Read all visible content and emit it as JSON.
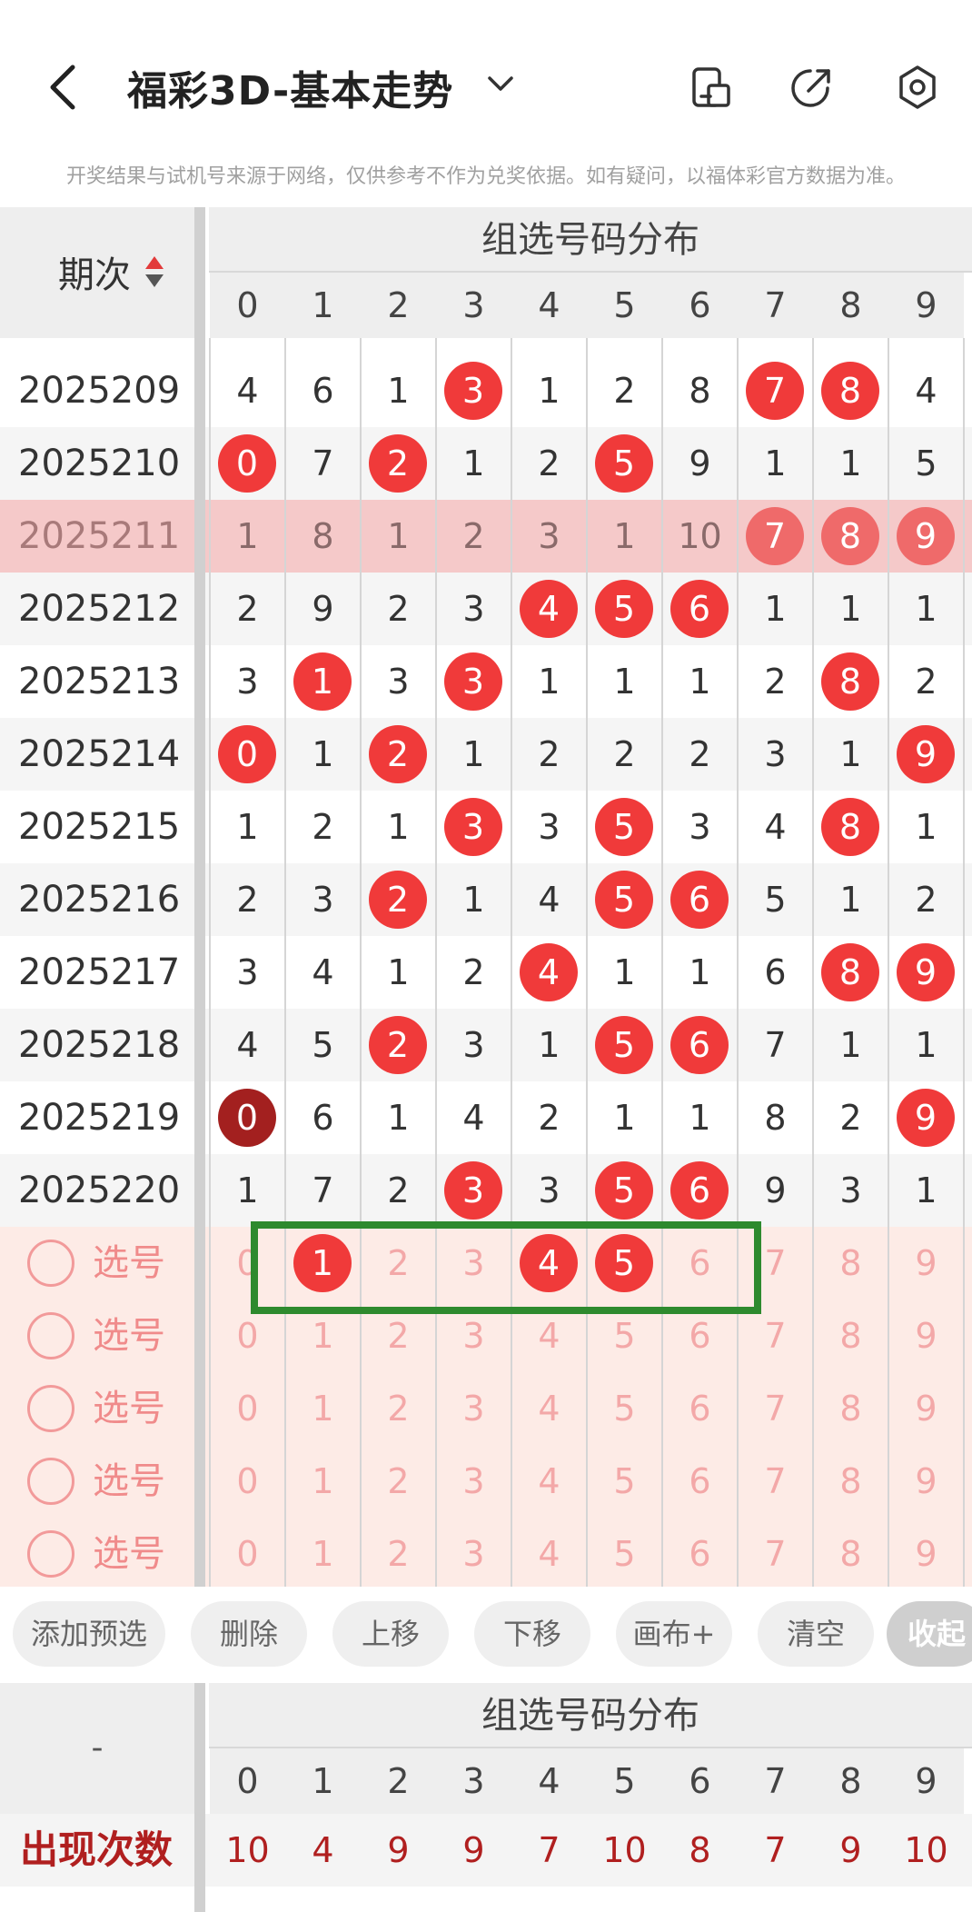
{
  "header": {
    "title": "福彩3D-基本走势",
    "notice": "开奖结果与试机号来源于网络，仅供参考不作为兑奖依据。如有疑问，以福体彩官方数据为准。",
    "icons": [
      "back-icon",
      "chevron-down-icon",
      "phone-icon",
      "share-icon",
      "settings-icon"
    ]
  },
  "table": {
    "period_label": "期次",
    "group_title": "组选号码分布",
    "digits": [
      "0",
      "1",
      "2",
      "3",
      "4",
      "5",
      "6",
      "7",
      "8",
      "9"
    ],
    "rows": [
      {
        "period": "2025209",
        "cells": [
          "4",
          "6",
          "1",
          "3",
          "1",
          "2",
          "8",
          "7",
          "8",
          "4"
        ],
        "hits": [
          3,
          7,
          8
        ]
      },
      {
        "period": "2025210",
        "cells": [
          "0",
          "7",
          "2",
          "1",
          "2",
          "5",
          "9",
          "1",
          "1",
          "5"
        ],
        "hits": [
          0,
          2,
          5
        ]
      },
      {
        "period": "2025211",
        "cells": [
          "1",
          "8",
          "1",
          "2",
          "3",
          "1",
          "10",
          "7",
          "8",
          "9"
        ],
        "hits": [
          7,
          8,
          9
        ],
        "highlight": true
      },
      {
        "period": "2025212",
        "cells": [
          "2",
          "9",
          "2",
          "3",
          "4",
          "5",
          "6",
          "1",
          "1",
          "1"
        ],
        "hits": [
          4,
          5,
          6
        ]
      },
      {
        "period": "2025213",
        "cells": [
          "3",
          "1",
          "3",
          "3",
          "1",
          "1",
          "1",
          "2",
          "8",
          "2"
        ],
        "hits": [
          1,
          3,
          8
        ]
      },
      {
        "period": "2025214",
        "cells": [
          "0",
          "1",
          "2",
          "1",
          "2",
          "2",
          "2",
          "3",
          "1",
          "9"
        ],
        "hits": [
          0,
          2,
          9
        ]
      },
      {
        "period": "2025215",
        "cells": [
          "1",
          "2",
          "1",
          "3",
          "3",
          "5",
          "3",
          "4",
          "8",
          "1"
        ],
        "hits": [
          3,
          5,
          8
        ]
      },
      {
        "period": "2025216",
        "cells": [
          "2",
          "3",
          "2",
          "1",
          "4",
          "5",
          "6",
          "5",
          "1",
          "2"
        ],
        "hits": [
          2,
          5,
          6
        ]
      },
      {
        "period": "2025217",
        "cells": [
          "3",
          "4",
          "1",
          "2",
          "4",
          "1",
          "1",
          "6",
          "8",
          "9"
        ],
        "hits": [
          4,
          8,
          9
        ]
      },
      {
        "period": "2025218",
        "cells": [
          "4",
          "5",
          "2",
          "3",
          "1",
          "5",
          "6",
          "7",
          "1",
          "1"
        ],
        "hits": [
          2,
          5,
          6
        ]
      },
      {
        "period": "2025219",
        "cells": [
          "0",
          "6",
          "1",
          "4",
          "2",
          "1",
          "1",
          "8",
          "2",
          "9"
        ],
        "hits": [
          0,
          9
        ],
        "dark_hits": [
          0
        ]
      },
      {
        "period": "2025220",
        "cells": [
          "1",
          "7",
          "2",
          "3",
          "3",
          "5",
          "6",
          "9",
          "3",
          "1"
        ],
        "hits": [
          3,
          5,
          6
        ]
      }
    ]
  },
  "picks": {
    "label": "选号",
    "rows": [
      {
        "selected": [
          1,
          4,
          5
        ]
      },
      {
        "selected": []
      },
      {
        "selected": []
      },
      {
        "selected": []
      },
      {
        "selected": []
      }
    ]
  },
  "actions": {
    "add": "添加预选",
    "delete": "删除",
    "up": "上移",
    "down": "下移",
    "canvas": "画布+",
    "clear": "清空",
    "collapse": "收起"
  },
  "stats": {
    "left_label": "-",
    "group_title": "组选号码分布",
    "appear_label": "出现次数",
    "appear_values": [
      "10",
      "4",
      "9",
      "9",
      "7",
      "10",
      "8",
      "7",
      "9",
      "10"
    ]
  },
  "colors": {
    "ball": "#f03a3a",
    "ball_dark": "#a3201f",
    "highlight_row": "#f5c9c9",
    "pick_bg": "#fdebe6",
    "box": "#2e8a2e",
    "stat_text": "#b01f1f"
  }
}
